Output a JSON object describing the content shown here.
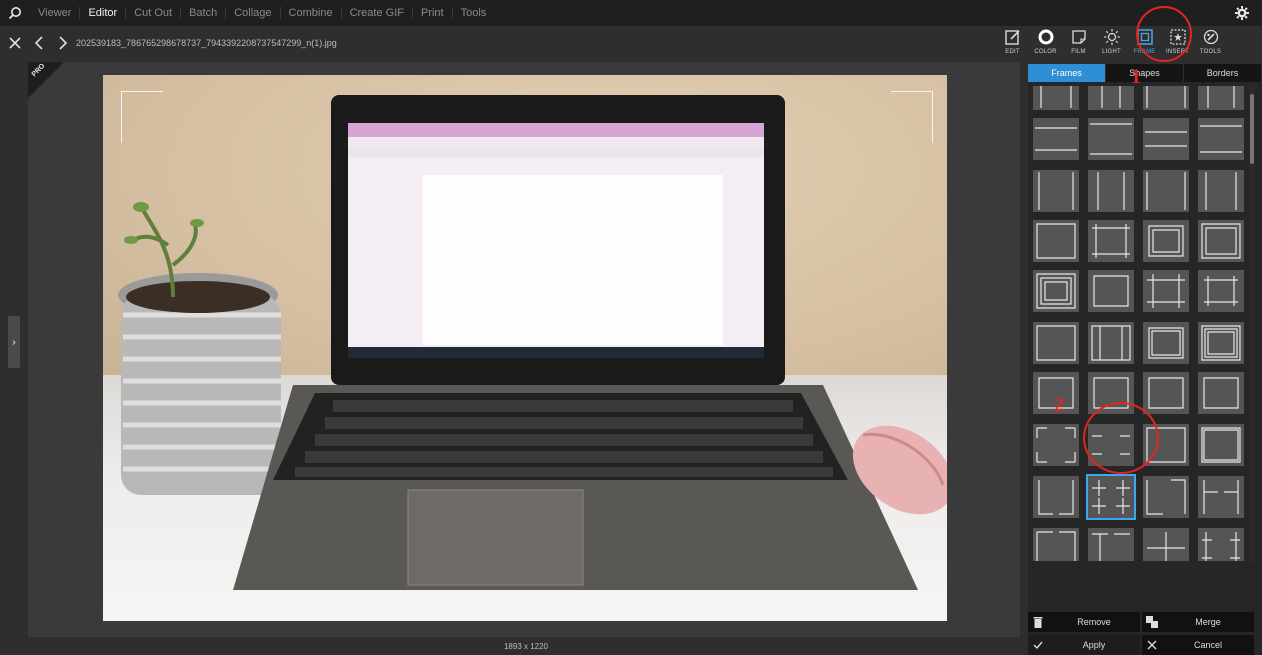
{
  "menu": {
    "items": [
      "Viewer",
      "Editor",
      "Cut Out",
      "Batch",
      "Collage",
      "Combine",
      "Create GIF",
      "Print",
      "Tools"
    ],
    "active": "Editor"
  },
  "title": {
    "filename": "202539183_786765298678737_7943392208737547299_n(1).jpg"
  },
  "toolbar": {
    "tools": [
      {
        "label": "EDIT",
        "icon": "edit-icon"
      },
      {
        "label": "COLOR",
        "icon": "color-icon"
      },
      {
        "label": "FILM",
        "icon": "film-icon"
      },
      {
        "label": "LIGHT",
        "icon": "light-icon"
      },
      {
        "label": "FRAME",
        "icon": "frame-icon"
      },
      {
        "label": "INSERT",
        "icon": "insert-icon"
      },
      {
        "label": "TOOLS",
        "icon": "tools-icon"
      }
    ],
    "active": "FRAME"
  },
  "badge": {
    "pro": "PRO"
  },
  "canvas": {
    "dimensions": "1893 x 1220"
  },
  "panel": {
    "tabs": [
      "Frames",
      "Shapes",
      "Borders"
    ],
    "active_tab": "Frames",
    "selected_frame_index": 33
  },
  "actions": {
    "remove": "Remove",
    "merge": "Merge",
    "apply": "Apply",
    "cancel": "Cancel"
  },
  "annotations": {
    "one": "1",
    "two": "2"
  },
  "colors": {
    "accent": "#2d8fd6",
    "annotation": "#e32420"
  }
}
